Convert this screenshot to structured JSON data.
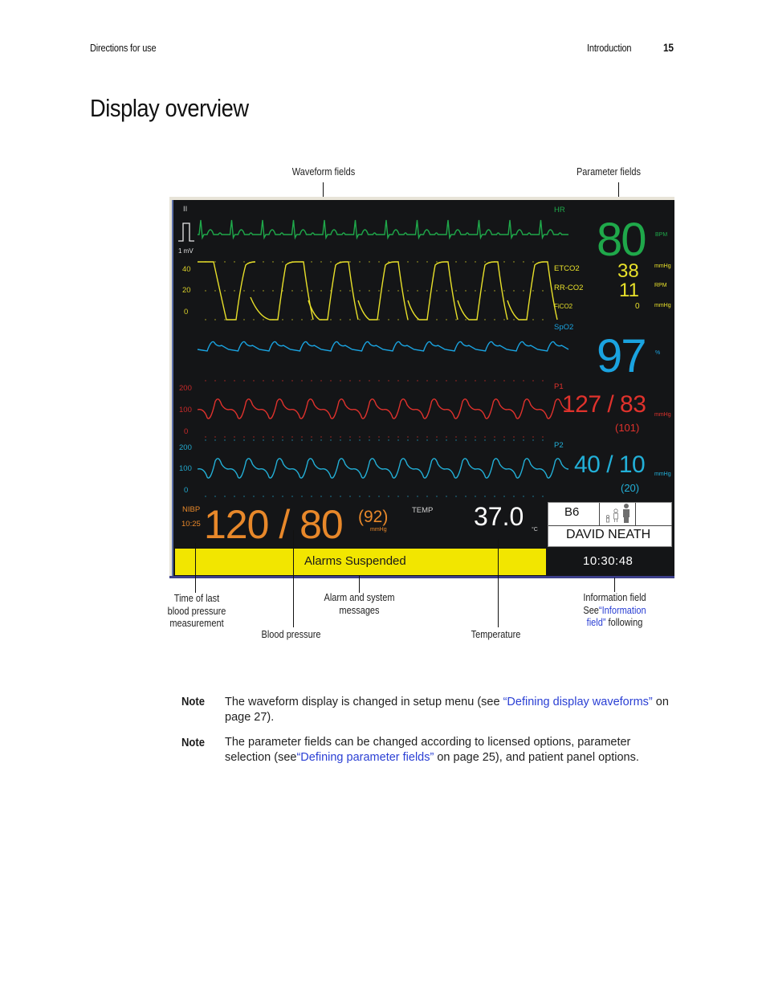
{
  "header": {
    "left": "Directions for use",
    "section": "Introduction",
    "page_number": "15"
  },
  "title": "Display overview",
  "callouts": {
    "waveform_fields": "Waveform fields",
    "parameter_fields": "Parameter fields",
    "time_last_bp_line1": "Time of last",
    "time_last_bp_line2": "blood pressure",
    "time_last_bp_line3": "measurement",
    "blood_pressure": "Blood pressure",
    "alarm_line1": "Alarm and system",
    "alarm_line2": "messages",
    "temperature": "Temperature",
    "info_line1": "Information field",
    "info_line2_prefix": "See",
    "info_link_part1": "“Information",
    "info_link_part2": "field”",
    "info_line3_suffix": " following"
  },
  "monitor": {
    "colors": {
      "background": "#141517",
      "ecg": "#1fa84a",
      "co2": "#e8e02a",
      "spo2": "#1aa3e0",
      "p1": "#e0322c",
      "p2": "#22b0d8",
      "nibp": "#e8882a",
      "white": "#ffffff",
      "alarm_bar": "#f2e600"
    },
    "waveforms": {
      "ecg": {
        "lead": "II",
        "scale": "1 mV"
      },
      "co2": {
        "scale": [
          "40",
          "20",
          "0"
        ]
      },
      "p1": {
        "scale": [
          "200",
          "100",
          "0"
        ]
      },
      "p2": {
        "scale": [
          "200",
          "100",
          "0"
        ]
      }
    },
    "parameters": {
      "hr": {
        "label": "HR",
        "value": "80",
        "unit": "BPM"
      },
      "etco2": {
        "label": "ETCO2",
        "value": "38",
        "unit": "mmHg"
      },
      "rrco2": {
        "label": "RR-CO2",
        "value": "11",
        "unit": "RPM"
      },
      "fico2": {
        "label": "FiCO2",
        "value": "0",
        "unit": "mmHg"
      },
      "spo2": {
        "label": "SpO2",
        "value": "97",
        "unit": "%"
      },
      "p1": {
        "label": "P1",
        "value": "127 / 83",
        "mean": "(101)",
        "unit": "mmHg"
      },
      "p2": {
        "label": "P2",
        "value": "40 / 10",
        "mean": "(20)",
        "unit": "mmHg"
      }
    },
    "nibp": {
      "label": "NIBP",
      "time": "10:25",
      "value": "120 / 80",
      "mean": "(92)",
      "unit": "mmHg"
    },
    "temp": {
      "label": "TEMP",
      "value": "37.0",
      "unit": "°C"
    },
    "alarm_message": "Alarms Suspended",
    "info": {
      "bed": "B6",
      "patient_name": "DAVID NEATH",
      "clock": "10:30:48"
    }
  },
  "notes": [
    {
      "label": "Note",
      "text_before": "The waveform display is changed in setup menu (see ",
      "link": "“Defining display waveforms”",
      "text_after": " on page 27)."
    },
    {
      "label": "Note",
      "text_before": "The parameter fields can be changed according to licensed options, parameter selection (see",
      "link": "“Defining parameter fields”",
      "text_after": " on page 25), and patient panel options."
    }
  ]
}
